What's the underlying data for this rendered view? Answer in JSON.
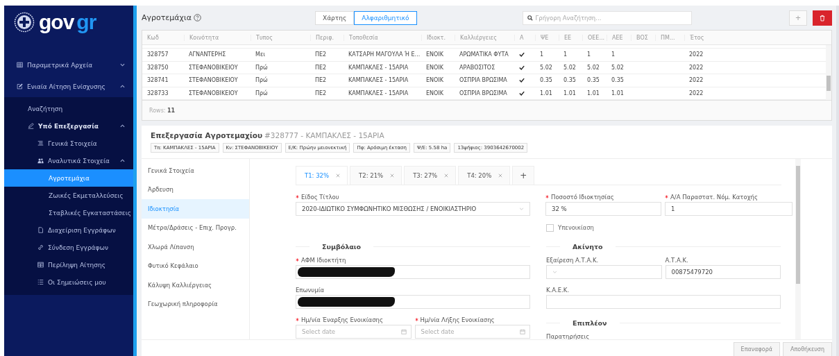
{
  "sidebar": {
    "logo": {
      "text": "gov",
      "accent": "gr"
    },
    "items": [
      {
        "label": "Παραμετρικά Αρχεία",
        "selected": false,
        "expanded": false
      },
      {
        "label": "Ενιαία Αίτηση Ενίσχυσης",
        "selected": false,
        "expanded": true,
        "children": [
          {
            "label": "Αναζήτηση",
            "selected": false
          },
          {
            "label": "Υπό Επεξεργασία",
            "selected": false,
            "expanded": true,
            "children": [
              {
                "label": "Γενικά Στοιχεία",
                "selected": false
              },
              {
                "label": "Αναλυτικά Στοιχεία",
                "selected": false,
                "expanded": true,
                "children": [
                  {
                    "label": "Αγροτεμάχια",
                    "selected": true
                  },
                  {
                    "label": "Ζωικές Εκμεταλλεύσεις",
                    "selected": false
                  },
                  {
                    "label": "Σταβλικές Εγκαταστάσεις",
                    "selected": false
                  }
                ]
              },
              {
                "label": "Διαχείριση Εγγράφων",
                "selected": false
              },
              {
                "label": "Σύνδεση Εγγράφων",
                "selected": false
              },
              {
                "label": "Περίληψη Αίτησης",
                "selected": false
              },
              {
                "label": "Οι Σημειώσεις μου",
                "selected": false
              }
            ]
          }
        ]
      }
    ]
  },
  "header": {
    "title": "Αγροτεμάχια",
    "view_toggle": [
      {
        "label": "Χάρτης",
        "selected": false
      },
      {
        "label": "Αλφαριθμητικό",
        "selected": true
      }
    ],
    "search": {
      "placeholder": "Γρήγορη Αναζήτηση..."
    },
    "add_button": "+"
  },
  "table": {
    "columns": [
      "Κωδ",
      "Κοινότητα",
      "Τυπος",
      "Περιφ.",
      "Τοποθεσία",
      "Ιδιοκτ.",
      "Καλλιέργειες",
      "Α",
      "ΨΕ",
      "ΕΕ",
      "ΟΕΕ...",
      "ΑΕΕ",
      "ΒΟΣ",
      "ΠΜ...",
      "Έτος"
    ],
    "rows": [
      {
        "code": "328757",
        "community": "ΑΓΝΑΝΤΕΡΗΣ",
        "type": "Μει",
        "region": "ΠΕ2",
        "location": "ΚΑΤΣΑΡΗ ΜΑΓΟΥΛΑ Ή Ε...",
        "ownership": "ΕΝΟΙΚ",
        "crops": "ΑΡΩΜΑΤΙΚΑ ΦΥΤΑ",
        "a": true,
        "pse": "1",
        "ee": "1",
        "oee": "1",
        "aee": "1",
        "year": "2022"
      },
      {
        "code": "328750",
        "community": "ΣΤΕΦΑΝΟΒΙΚΕΙΟΥ",
        "type": "Πρώ",
        "region": "ΠΕ2",
        "location": "ΚΑΜΠΑΚΛΕΣ - 15ΑΡΙΑ",
        "ownership": "ΕΝΟΙΚ",
        "crops": "ΑΡΑΒΟΣΙΤΟΣ",
        "a": true,
        "pse": "5.02",
        "ee": "5.02",
        "oee": "5.02",
        "aee": "5.02",
        "year": "2022"
      },
      {
        "code": "328741",
        "community": "ΣΤΕΦΑΝΟΒΙΚΕΙΟΥ",
        "type": "Πρώ",
        "region": "ΠΕ2",
        "location": "ΚΑΜΠΑΚΛΕΣ - 15ΑΡΙΑ",
        "ownership": "ΕΝΟΙΚ",
        "crops": "ΟΣΠΡΙΑ ΒΡΩΣΙΜΑ",
        "a": true,
        "pse": "0.35",
        "ee": "0.35",
        "oee": "0.35",
        "aee": "0.35",
        "year": "2022"
      },
      {
        "code": "328733",
        "community": "ΣΤΕΦΑΝΟΒΙΚΕΙΟΥ",
        "type": "Πρώ",
        "region": "ΠΕ2",
        "location": "ΚΑΜΠΑΚΛΕΣ - 15ΑΡΙΑ",
        "ownership": "ΕΝΟΙΚ",
        "crops": "ΟΣΠΡΙΑ ΒΡΩΣΙΜΑ",
        "a": true,
        "pse": "1.01",
        "ee": "1.01",
        "oee": "1.01",
        "aee": "1.01",
        "year": "2022"
      }
    ],
    "footer": "Rows: **11**"
  },
  "detail": {
    "title": "Επεξεργασία Αγροτεμαχίου",
    "subtitle": "#328777 - ΚΑΜΠΑΚΛΕΣ - 15ΑΡΙΑ",
    "tags": [
      "Τπ: ΚΑΜΠΑΚΛΕΣ - 15ΑΡΙΑ",
      "Κν: ΣΤΕΦΑΝΟΒΙΚΕΙΟΥ",
      "Ε/Κ: Πρώην μειονεκτική",
      "Πφ: Αρόσιμη έκταση",
      "Ψ/Ε: 5.58 ha",
      "13ψήφιος: 3903642670002"
    ],
    "nav": [
      {
        "label": "Γενικά Στοιχεία",
        "selected": false
      },
      {
        "label": "Άρδευση",
        "selected": false
      },
      {
        "label": "Ιδιοκτησία",
        "selected": true
      },
      {
        "label": "Μέτρα/Δράσεις - Επιχ. Προγρ.",
        "selected": false
      },
      {
        "label": "Χλωρά Λίπανση",
        "selected": false
      },
      {
        "label": "Φυτικό Κεφάλαιο",
        "selected": false
      },
      {
        "label": "Κάλυψη Καλλιέργειας",
        "selected": false
      },
      {
        "label": "Γεωχωρική πληροφορία",
        "selected": false
      }
    ],
    "tabs": [
      {
        "label": "T1: 32%",
        "selected": true
      },
      {
        "label": "T2: 21%",
        "selected": false
      },
      {
        "label": "T3: 27%",
        "selected": false
      },
      {
        "label": "T4: 20%",
        "selected": false
      }
    ],
    "add_tab": "+",
    "form": {
      "title_type": {
        "label": "Είδος Τίτλου",
        "required": true,
        "value": "2020-ΙΔΙΩΤΙΚΟ ΣΥΜΦΩΝΗΤΙΚΟ ΜΙΣΘΩΣΗΣ / ΕΝΟΙΚΙΑΣΤΗΡΙΟ"
      },
      "ownership_pct": {
        "label": "Ποσοστό Ιδιοκτησίας",
        "required": true,
        "value": "32 %"
      },
      "document_no": {
        "label": "Α/Α Παραστατ. Νόμ. Κατοχής",
        "required": true,
        "value": "1"
      },
      "sublease": {
        "label": "Υπενοικίαση",
        "checked": false
      },
      "contract": {
        "heading": "Συμβόλαιο",
        "owner_vat": {
          "label": "ΑΦΜ Ιδιοκτήτη",
          "required": true,
          "redacted": true
        },
        "name": {
          "label": "Επωνυμία",
          "required": false,
          "redacted": true
        },
        "start": {
          "label": "Ημ/νία Έναρξης Ενοικίασης",
          "required": true,
          "placeholder": "Select date"
        },
        "end": {
          "label": "Ημ/νία Λήξης Ενοικίασης",
          "required": true,
          "placeholder": "Select date"
        }
      },
      "property": {
        "heading": "Ακίνητο",
        "atak_exemption": {
          "label": "Εξαίρεση Α.Τ.Α.Κ.",
          "required": false
        },
        "atak": {
          "label": "Α.Τ.Α.Κ.",
          "required": false,
          "value": "00875479720"
        },
        "kaek": {
          "label": "Κ.Α.Ε.Κ.",
          "required": false
        }
      },
      "extra": {
        "heading": "Επιπλέον",
        "remarks": {
          "label": "Παρατηρήσεις",
          "required": false
        }
      }
    },
    "footer_buttons": [
      {
        "label": "Επαναφορά",
        "disabled": true
      },
      {
        "label": "Αποθήκευση",
        "disabled": true
      }
    ]
  }
}
